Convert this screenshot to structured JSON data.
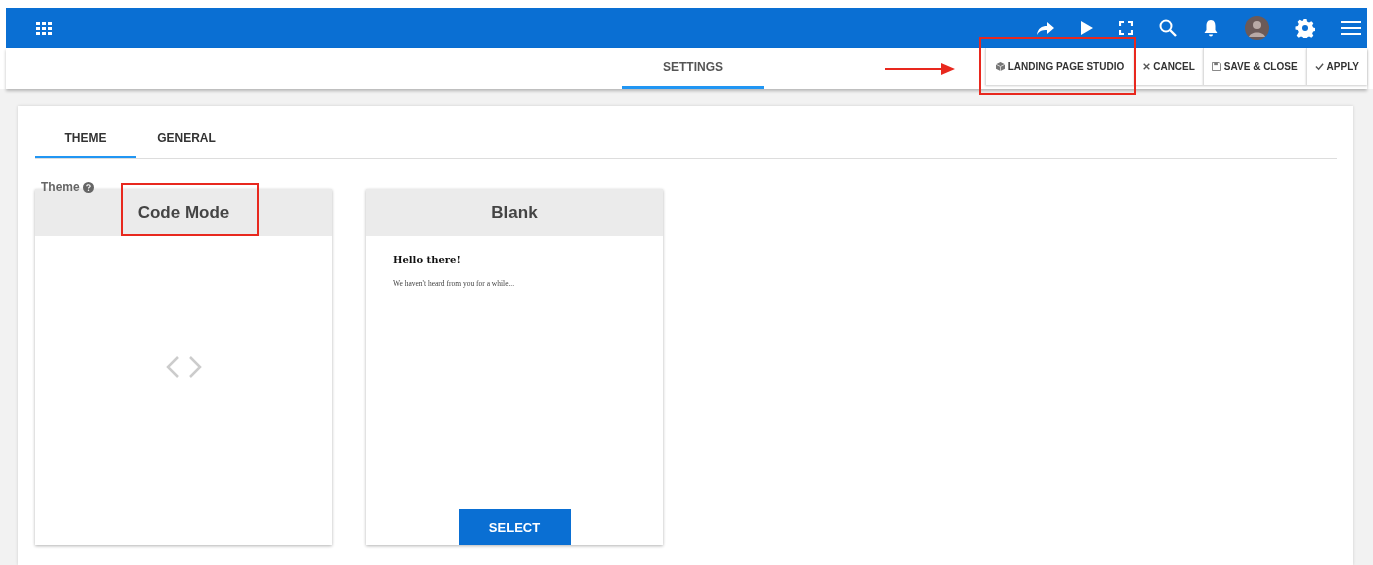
{
  "header": {
    "tab": {
      "label": "SETTINGS",
      "selected": true
    },
    "buttons": [
      {
        "label": "LANDING PAGE STUDIO",
        "kind": "cube"
      },
      {
        "label": "CANCEL",
        "kind": "close"
      },
      {
        "label": "SAVE & CLOSE",
        "kind": "save"
      },
      {
        "label": "APPLY",
        "kind": "check"
      }
    ]
  },
  "tabs": [
    {
      "label": "THEME",
      "selected": true
    },
    {
      "label": "GENERAL",
      "selected": false
    }
  ],
  "theme_label": "Theme",
  "cards": [
    {
      "kind": "code",
      "title": "Code Mode"
    },
    {
      "kind": "preview",
      "title": "Blank",
      "preview_heading": "Hello there!",
      "preview_text": "We haven't heard from you for a while...",
      "button": "SELECT"
    }
  ]
}
